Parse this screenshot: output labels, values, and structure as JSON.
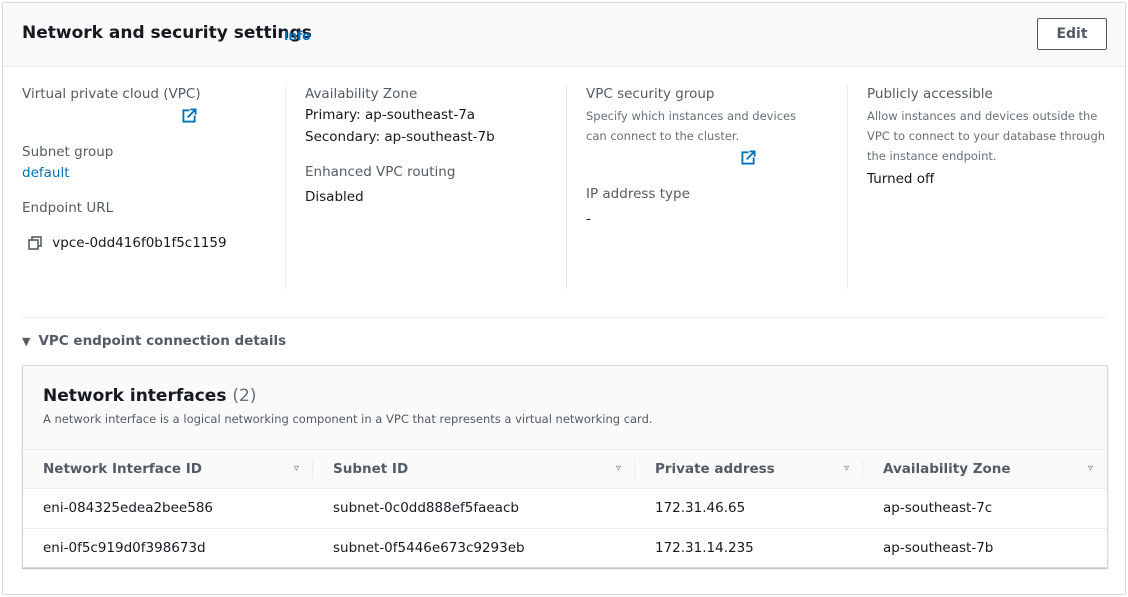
{
  "header": {
    "title": "Network and security settings",
    "info_label": "Info",
    "edit_label": "Edit"
  },
  "details": {
    "vpc": {
      "label": "Virtual private cloud (VPC)",
      "value": "",
      "icon": "external-link-icon"
    },
    "subnet_group": {
      "label": "Subnet group",
      "value": "default"
    },
    "endpoint_url": {
      "label": "Endpoint URL",
      "value": "vpce-0dd416f0b1f5c1159",
      "icon": "copy-icon"
    },
    "availability_zone": {
      "label": "Availability Zone",
      "primary": "Primary: ap-southeast-7a",
      "secondary": "Secondary: ap-southeast-7b"
    },
    "enhanced_vpc_routing": {
      "label": "Enhanced VPC routing",
      "value": "Disabled"
    },
    "vpc_security_group": {
      "label": "VPC security group",
      "description": "Specify which instances and devices can connect to the cluster.",
      "value": "",
      "icon": "external-link-icon"
    },
    "ip_address_type": {
      "label": "IP address type",
      "value": "-"
    },
    "publicly_accessible": {
      "label": "Publicly accessible",
      "description": "Allow instances and devices outside the VPC to connect to your database through the instance endpoint.",
      "value": "Turned off"
    }
  },
  "expander": {
    "label": "VPC endpoint connection details",
    "expanded": true
  },
  "network_interfaces": {
    "title": "Network interfaces",
    "count": "(2)",
    "description": "A network interface is a logical networking component in a VPC that represents a virtual networking card.",
    "columns": [
      "Network Interface ID",
      "Subnet ID",
      "Private address",
      "Availability Zone"
    ],
    "rows": [
      [
        "eni-084325edea2bee586",
        "subnet-0c0dd888ef5faeacb",
        "172.31.46.65",
        "ap-southeast-7c"
      ],
      [
        "eni-0f5c919d0f398673d",
        "subnet-0f5446e673c9293eb",
        "172.31.14.235",
        "ap-southeast-7b"
      ]
    ]
  },
  "colors": {
    "link": "#0073bb",
    "text": "#16191f",
    "label": "#545b64",
    "border": "#d5dbdb"
  }
}
